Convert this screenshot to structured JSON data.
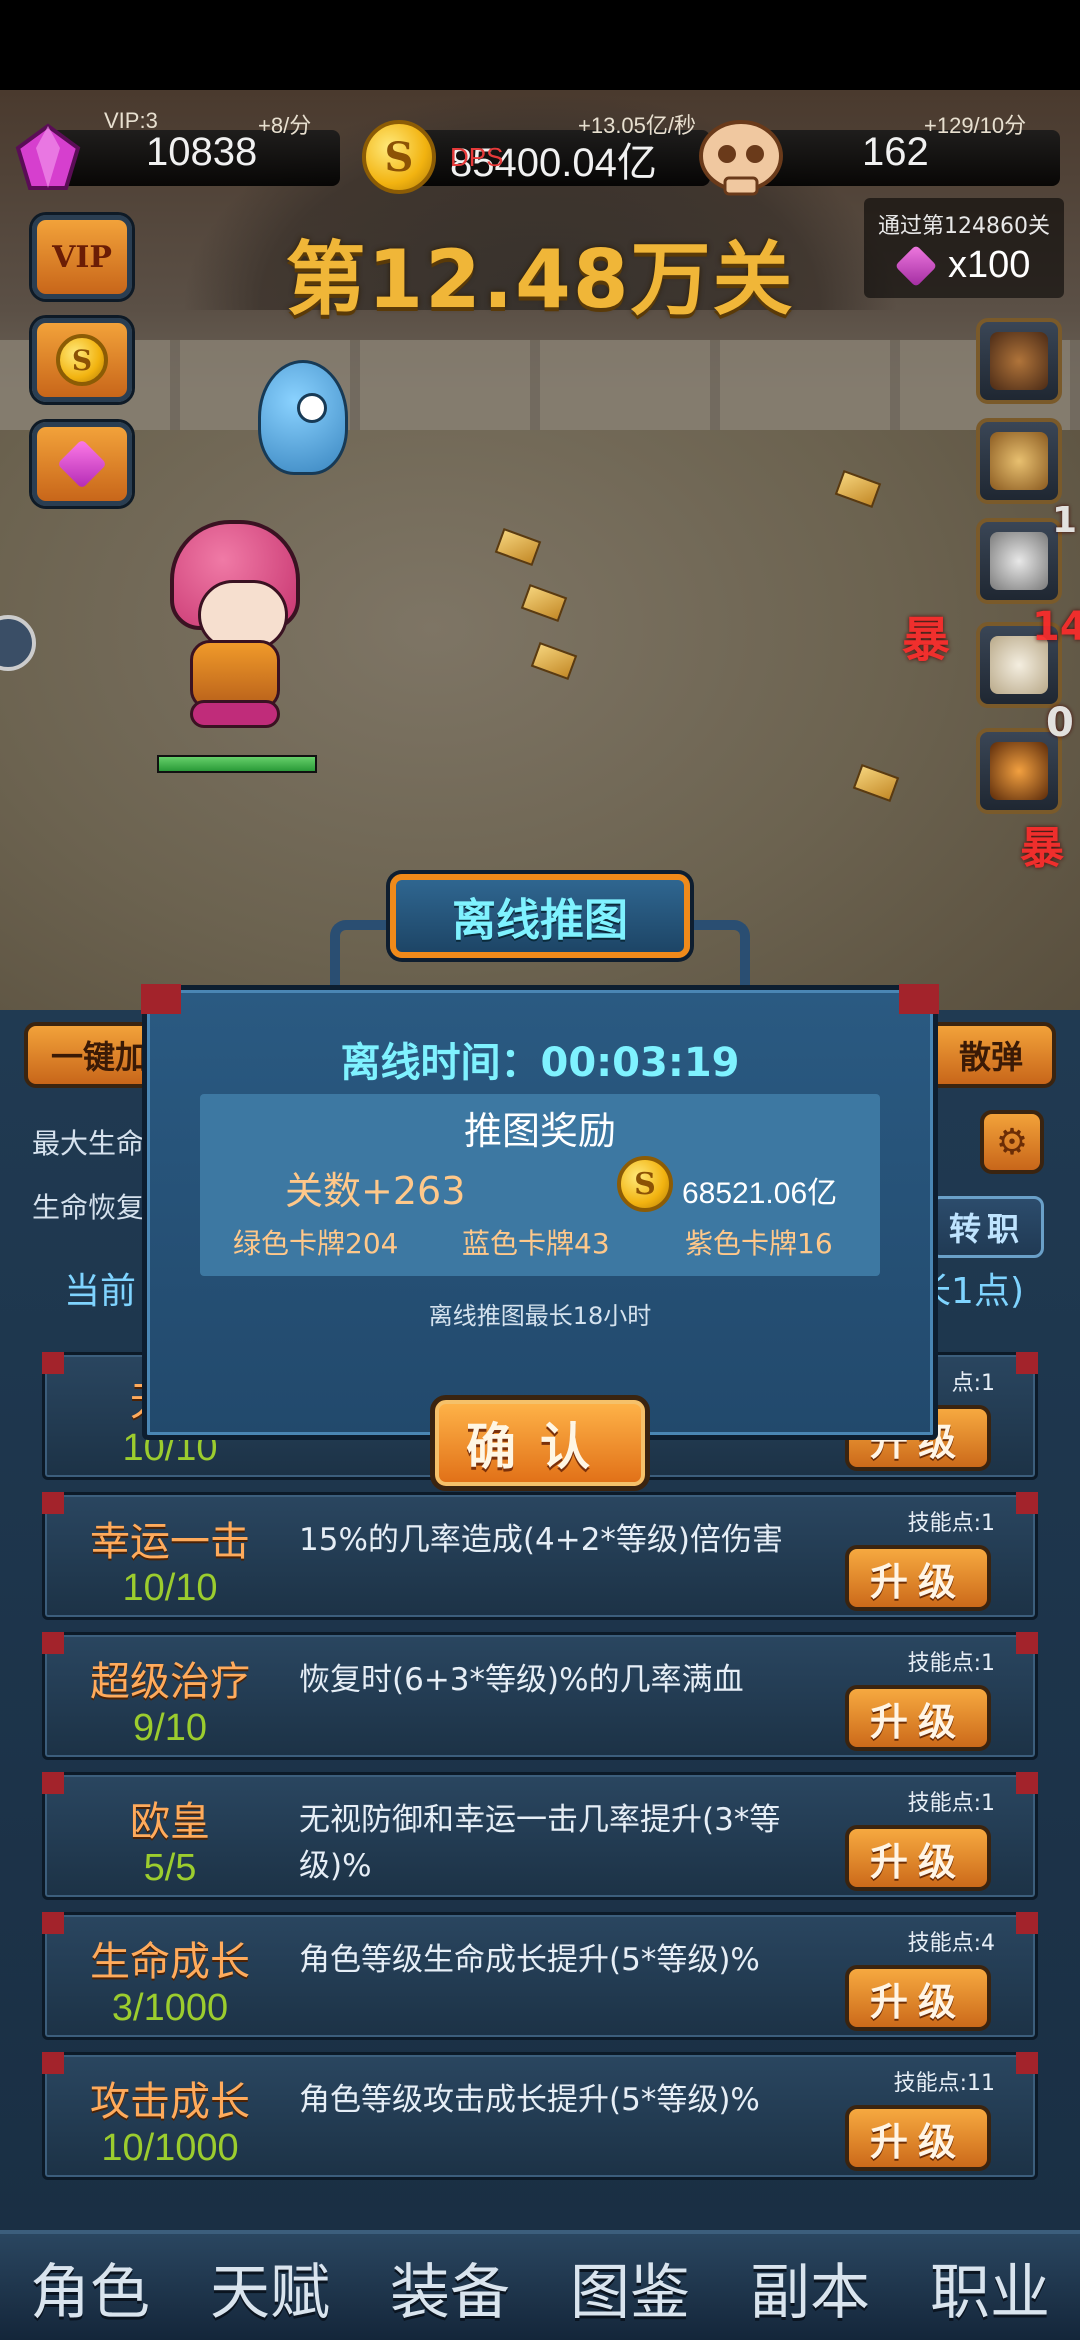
{
  "hud": {
    "vip_label": "VIP:3",
    "gems": "10838",
    "gem_rate": "+8/分",
    "gold": "85400.04亿",
    "gold_rate": "+13.05亿/秒",
    "dps_label": "DPS",
    "skulls": "162",
    "skull_rate": "+129/10分"
  },
  "stage": {
    "title": "第12.48万关",
    "pass_label": "通过第124860关",
    "pass_reward": "x100"
  },
  "side_buttons": [
    "VIP",
    "S"
  ],
  "actions": {
    "left_label": "一键加",
    "right_label": "散弹"
  },
  "stats": {
    "max_hp_label": "最大生命",
    "regen_label": "生命恢复",
    "job_label": "转职",
    "current_label": "当前",
    "points_suffix": "长1点)"
  },
  "dialog": {
    "title": "离线推图",
    "offline_time": "离线时间：00:03:19",
    "reward_title": "推图奖励",
    "stage_gain": "关数+263",
    "gold_gain": "68521.06亿",
    "green_cards": "绿色卡牌204",
    "blue_cards": "蓝色卡牌43",
    "purple_cards": "紫色卡牌16",
    "note": "离线推图最长18小时",
    "confirm": "确认"
  },
  "skills": [
    {
      "name": "无视",
      "level": "10/10",
      "desc": "",
      "points": "点:1",
      "button": "升级"
    },
    {
      "name": "幸运一击",
      "level": "10/10",
      "desc": "15%的几率造成(4+2*等级)倍伤害",
      "points": "技能点:1",
      "button": "升级"
    },
    {
      "name": "超级治疗",
      "level": "9/10",
      "desc": "恢复时(6+3*等级)%的几率满血",
      "points": "技能点:1",
      "button": "升级"
    },
    {
      "name": "欧皇",
      "level": "5/5",
      "desc": "无视防御和幸运一击几率提升(3*等级)%",
      "points": "技能点:1",
      "button": "升级"
    },
    {
      "name": "生命成长",
      "level": "3/1000",
      "desc": "角色等级生命成长提升(5*等级)%",
      "points": "技能点:4",
      "button": "升级"
    },
    {
      "name": "攻击成长",
      "level": "10/1000",
      "desc": "角色等级攻击成长提升(5*等级)%",
      "points": "技能点:11",
      "button": "升级"
    }
  ],
  "tabs": [
    "角色",
    "天赋",
    "装备",
    "图鉴",
    "副本",
    "职业"
  ],
  "damage_texts": [
    "暴",
    "14",
    "1",
    "0"
  ],
  "colors": {
    "accent_orange": "#f2a23a",
    "panel_blue": "#2a5a82",
    "title_cyan": "#7ff2ff",
    "skill_name": "#ffab5c",
    "skill_level": "#9ccd2e"
  }
}
